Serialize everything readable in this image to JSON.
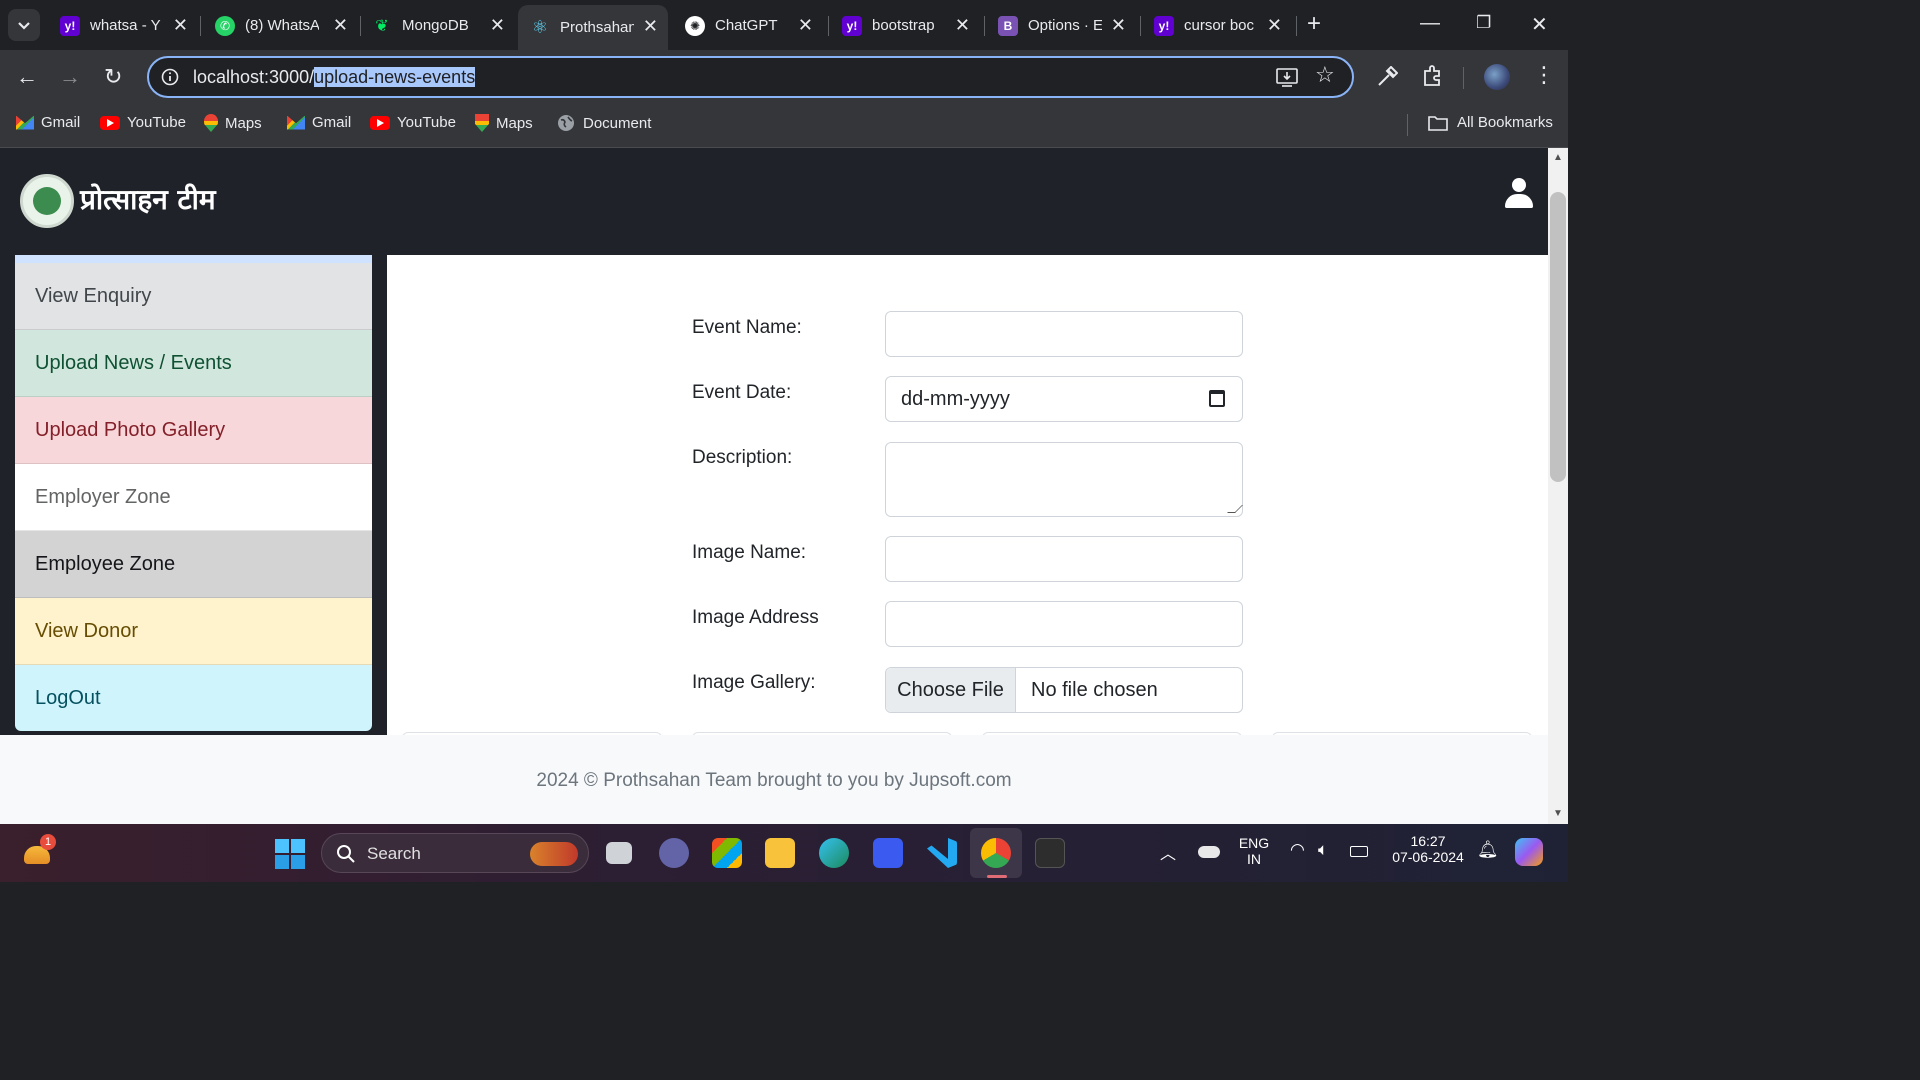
{
  "browser": {
    "tabs": [
      {
        "title": "whatsa - Y",
        "favicon": "yahoo-icon",
        "color": "#6001d2"
      },
      {
        "title": "(8) WhatsA",
        "favicon": "whatsapp-icon",
        "color": "#25d366"
      },
      {
        "title": "MongoDB",
        "favicon": "mongodb-icon",
        "color": "#00ed64"
      },
      {
        "title": "Prothsahan",
        "favicon": "react-icon",
        "color": "#61dafb",
        "active": true
      },
      {
        "title": "ChatGPT",
        "favicon": "chatgpt-icon",
        "color": "#ffffff"
      },
      {
        "title": "bootstrap",
        "favicon": "yahoo-icon",
        "color": "#6001d2"
      },
      {
        "title": "Options · E",
        "favicon": "bootstrap-icon",
        "color": "#7952b3"
      },
      {
        "title": "cursor boc",
        "favicon": "yahoo-icon",
        "color": "#6001d2"
      }
    ],
    "new_tab": "+",
    "address": {
      "host": "localhost:3000/",
      "path": "upload-news-events"
    },
    "bookmarks": [
      {
        "label": "Gmail",
        "icon": "gmail-icon"
      },
      {
        "label": "YouTube",
        "icon": "youtube-icon"
      },
      {
        "label": "Maps",
        "icon": "maps-icon"
      },
      {
        "label": "Gmail",
        "icon": "gmail-icon"
      },
      {
        "label": "YouTube",
        "icon": "youtube-icon"
      },
      {
        "label": "Maps",
        "icon": "maps-icon"
      },
      {
        "label": "Document",
        "icon": "globe-icon"
      }
    ],
    "all_bookmarks": "All Bookmarks"
  },
  "app": {
    "brand": "प्रोत्साहन टीम",
    "sidebar": [
      {
        "label": "View Enquiry",
        "bg": "#e2e3e5",
        "fg": "#41464b"
      },
      {
        "label": "Upload News / Events",
        "bg": "#d1e7dd",
        "fg": "#0f5132"
      },
      {
        "label": "Upload Photo Gallery",
        "bg": "#f8d7da",
        "fg": "#842029"
      },
      {
        "label": "Employer Zone",
        "bg": "#ffffff",
        "fg": "#636464"
      },
      {
        "label": "Employee Zone",
        "bg": "#d3d3d4",
        "fg": "#141619"
      },
      {
        "label": "View Donor",
        "bg": "#fff3cd",
        "fg": "#664d03"
      },
      {
        "label": "LogOut",
        "bg": "#cff4fc",
        "fg": "#055160"
      }
    ],
    "form": {
      "event_name_label": "Event Name:",
      "event_date_label": "Event Date:",
      "event_date_placeholder": "dd-mm-yyyy",
      "description_label": "Description:",
      "image_name_label": "Image Name:",
      "image_address_label": "Image Address",
      "image_gallery_label": "Image Gallery:",
      "choose_file": "Choose File",
      "no_file": "No file chosen"
    },
    "footer": "2024 © Prothsahan Team brought to you by Jupsoft.com"
  },
  "taskbar": {
    "search_label": "Search",
    "notification_count": "1",
    "language": "ENG",
    "region": "IN",
    "time": "16:27",
    "date": "07-06-2024"
  }
}
